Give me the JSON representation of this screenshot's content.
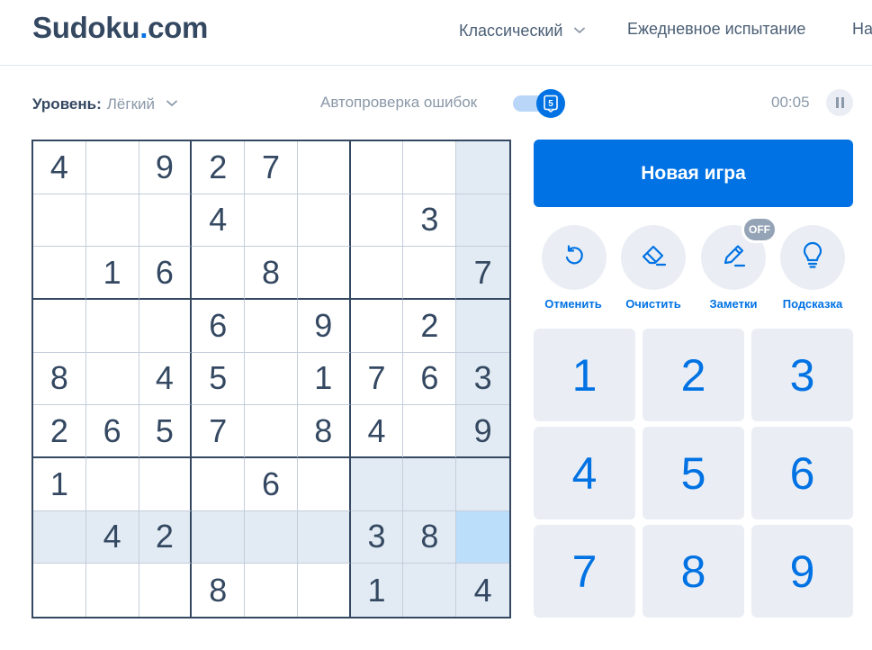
{
  "header": {
    "logo_main": "Sudoku",
    "logo_dot": ".",
    "logo_tld": "com",
    "nav": {
      "classic": "Классический",
      "daily": "Ежедневное испытание",
      "more": "На"
    }
  },
  "toolbar": {
    "difficulty_label": "Уровень:",
    "difficulty_value": "Лёгкий",
    "autocheck_label": "Автопроверка ошибок",
    "autocheck_on": true,
    "timer": "00:05"
  },
  "board": {
    "rows": [
      [
        "4",
        "",
        "9",
        "2",
        "7",
        "",
        "",
        "",
        ""
      ],
      [
        "",
        "",
        "",
        "4",
        "",
        "",
        "",
        "3",
        ""
      ],
      [
        "",
        "1",
        "6",
        "",
        "8",
        "",
        "",
        "",
        "7"
      ],
      [
        "",
        "",
        "",
        "6",
        "",
        "9",
        "",
        "2",
        ""
      ],
      [
        "8",
        "",
        "4",
        "5",
        "",
        "1",
        "7",
        "6",
        "3"
      ],
      [
        "2",
        "6",
        "5",
        "7",
        "",
        "8",
        "4",
        "",
        "9"
      ],
      [
        "1",
        "",
        "",
        "",
        "6",
        "",
        "",
        "",
        ""
      ],
      [
        "",
        "4",
        "2",
        "",
        "",
        "",
        "3",
        "8",
        ""
      ],
      [
        "",
        "",
        "",
        "8",
        "",
        "",
        "1",
        "",
        "4"
      ]
    ],
    "selected": {
      "row": 7,
      "col": 8
    }
  },
  "actions": {
    "new_game": "Новая игра",
    "tools": {
      "undo": "Отменить",
      "erase": "Очистить",
      "notes": "Заметки",
      "hint": "Подсказка"
    },
    "notes_badge": "OFF"
  },
  "numpad": [
    "1",
    "2",
    "3",
    "4",
    "5",
    "6",
    "7",
    "8",
    "9"
  ],
  "colors": {
    "accent": "#0072e3",
    "text": "#344861",
    "highlight": "#e2ebf3",
    "selected": "#bbdefb"
  },
  "icons": {
    "nav_chevron": "chevron-down-icon",
    "autocheck": "shield-check-icon",
    "pause": "pause-icon",
    "undo": "undo-icon",
    "erase": "eraser-icon",
    "notes": "pencil-icon",
    "hint": "lightbulb-icon"
  }
}
